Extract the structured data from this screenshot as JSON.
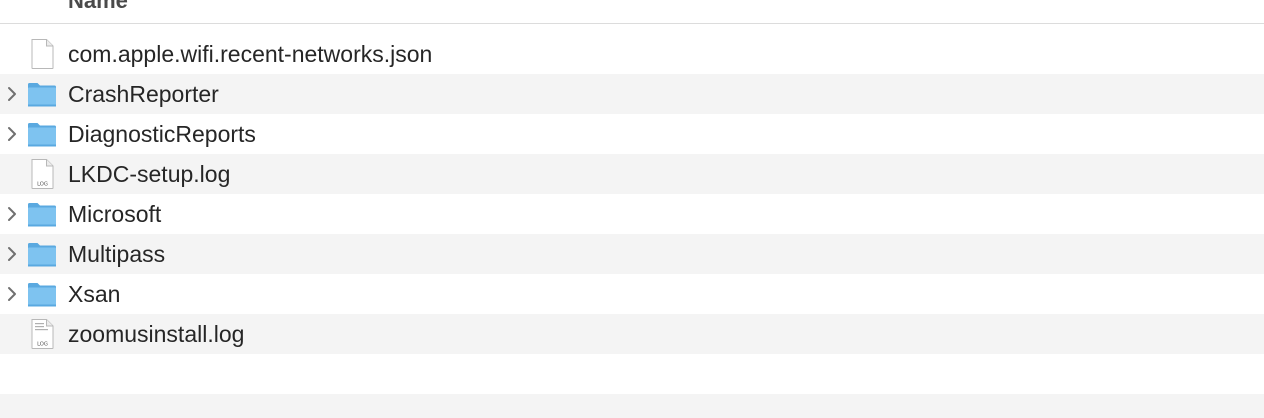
{
  "header": {
    "name_column": "Name"
  },
  "files": [
    {
      "name": "com.apple.wifi.recent-networks.json",
      "kind": "document",
      "icon": "generic-document-icon",
      "expandable": false
    },
    {
      "name": "CrashReporter",
      "kind": "folder",
      "icon": "folder-icon",
      "expandable": true
    },
    {
      "name": "DiagnosticReports",
      "kind": "folder",
      "icon": "folder-icon",
      "expandable": true
    },
    {
      "name": "LKDC-setup.log",
      "kind": "log",
      "icon": "log-file-icon",
      "expandable": false,
      "badge": "LOG"
    },
    {
      "name": "Microsoft",
      "kind": "folder",
      "icon": "folder-icon",
      "expandable": true
    },
    {
      "name": "Multipass",
      "kind": "folder",
      "icon": "folder-icon",
      "expandable": true
    },
    {
      "name": "Xsan",
      "kind": "folder",
      "icon": "folder-icon",
      "expandable": true
    },
    {
      "name": "zoomusinstall.log",
      "kind": "log",
      "icon": "log-file-icon",
      "expandable": false,
      "badge": "LOG"
    }
  ],
  "colors": {
    "row_stripe": "#f4f4f4",
    "folder_blue": "#7ec3f0",
    "folder_blue_dark": "#5aa9e0",
    "text": "#262626",
    "disclosure": "#707070"
  }
}
